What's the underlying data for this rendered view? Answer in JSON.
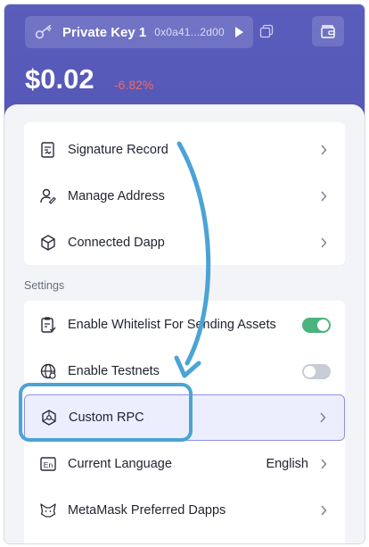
{
  "header": {
    "account_name": "Private Key 1",
    "account_address": "0x0a41...2d00",
    "balance": "$0.02",
    "change": "-6.82%"
  },
  "menu": {
    "group1": [
      {
        "label": "Signature Record",
        "icon": "signature-record-icon"
      },
      {
        "label": "Manage Address",
        "icon": "manage-address-icon"
      },
      {
        "label": "Connected Dapp",
        "icon": "connected-dapp-icon"
      }
    ],
    "settings_title": "Settings",
    "settings": [
      {
        "label": "Enable Whitelist For Sending Assets",
        "icon": "whitelist-icon",
        "toggle": true
      },
      {
        "label": "Enable Testnets",
        "icon": "testnets-globe-icon",
        "toggle": false
      },
      {
        "label": "Custom RPC",
        "icon": "custom-rpc-icon",
        "active": true
      },
      {
        "label": "Current Language",
        "icon": "language-icon",
        "value": "English"
      },
      {
        "label": "MetaMask Preferred Dapps",
        "icon": "metamask-fox-icon"
      }
    ]
  },
  "colors": {
    "header_bg": "#5a5cbb",
    "accent": "#8c92e8",
    "toggle_on": "#4bb37e",
    "negative": "#ee6a6a",
    "annotation": "#4ba3d6"
  }
}
